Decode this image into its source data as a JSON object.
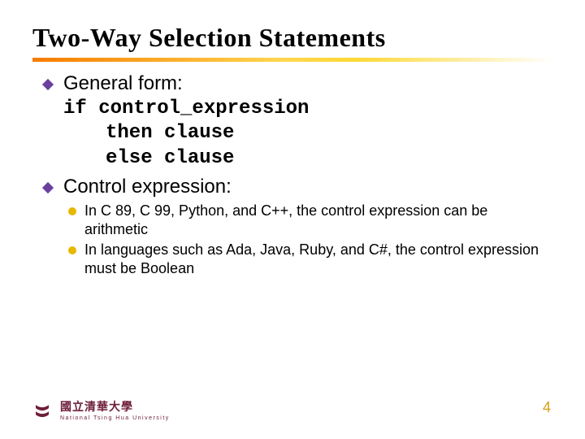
{
  "title": "Two-Way Selection Statements",
  "bullets": {
    "b1": {
      "text": "General form:"
    },
    "code": {
      "line1": "if control_expression",
      "line2": "then clause",
      "line3": "else clause"
    },
    "b2": {
      "text": "Control expression:"
    },
    "sub": {
      "s1": "In C 89, C 99, Python, and C++, the control expression can be arithmetic",
      "s2": "In languages such as Ada, Java, Ruby, and C#, the control expression must be Boolean"
    }
  },
  "footer": {
    "university_cn": "國立清華大學",
    "university_en": "National Tsing Hua University"
  },
  "page_number": "4"
}
